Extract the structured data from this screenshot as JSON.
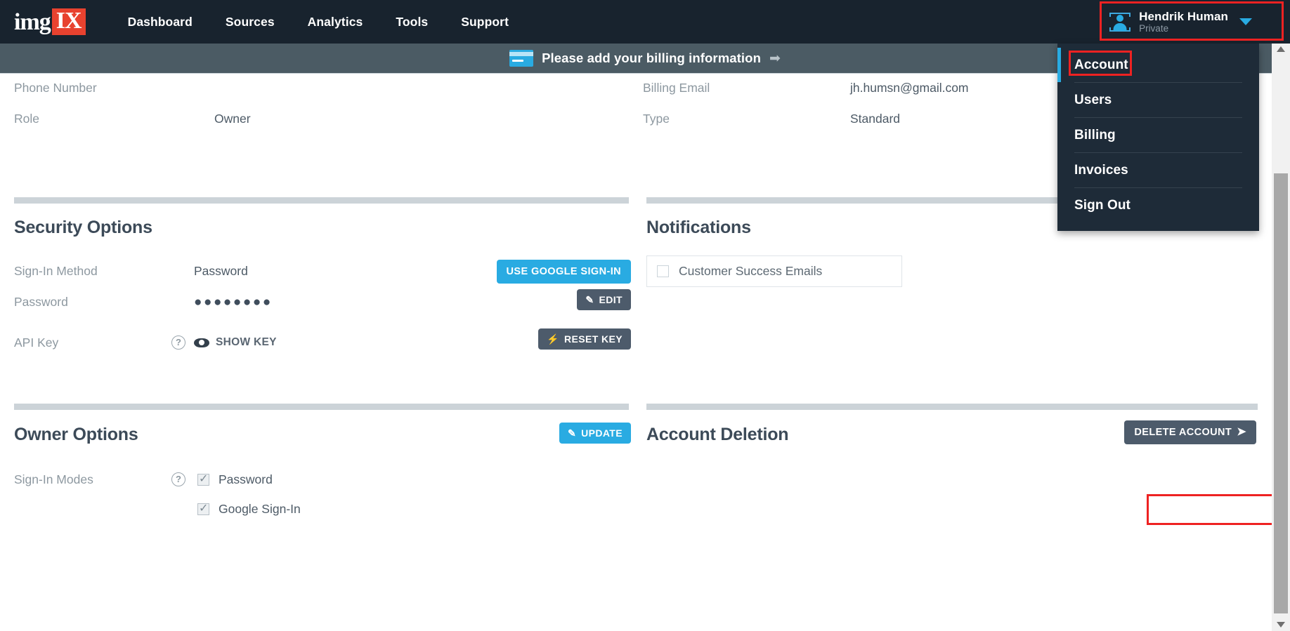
{
  "brand": {
    "logo_img": "img",
    "logo_ix": "IX",
    "accent": "#29abe2",
    "logo_red": "#e8422f"
  },
  "nav": {
    "items": [
      {
        "label": "Dashboard",
        "name": "nav-dashboard"
      },
      {
        "label": "Sources",
        "name": "nav-sources"
      },
      {
        "label": "Analytics",
        "name": "nav-analytics"
      },
      {
        "label": "Tools",
        "name": "nav-tools"
      },
      {
        "label": "Support",
        "name": "nav-support"
      }
    ]
  },
  "user": {
    "name": "Hendrik Human",
    "subtitle": "Private",
    "avatar_icon": "user-avatar-icon",
    "chevron_icon": "chevron-down-icon"
  },
  "user_menu": {
    "items": [
      {
        "label": "Account",
        "active": true
      },
      {
        "label": "Users",
        "active": false
      },
      {
        "label": "Billing",
        "active": false
      },
      {
        "label": "Invoices",
        "active": false
      },
      {
        "label": "Sign Out",
        "active": false
      }
    ]
  },
  "banner": {
    "icon": "credit-card-icon",
    "text": "Please add your billing information",
    "arrow": "➡"
  },
  "account_info": {
    "left": [
      {
        "label": "Phone Number",
        "value": ""
      },
      {
        "label": "Role",
        "value": "Owner"
      }
    ],
    "right": [
      {
        "label": "Billing Email",
        "value": "jh.humsn@gmail.com"
      },
      {
        "label": "Type",
        "value": "Standard"
      }
    ]
  },
  "security": {
    "title": "Security Options",
    "rows": {
      "signin_method": {
        "label": "Sign-In Method",
        "value": "Password"
      },
      "password": {
        "label": "Password",
        "value": "●●●●●●●●"
      },
      "api_key": {
        "label": "API Key",
        "help_icon": "help-circle-icon",
        "show_key": "SHOW KEY",
        "eye_icon": "eye-icon"
      }
    },
    "buttons": {
      "google_signin": "USE GOOGLE SIGN-IN",
      "edit": "EDIT",
      "reset_key": "RESET KEY"
    },
    "icons": {
      "edit": "pencil-icon",
      "reset": "bolt-icon"
    }
  },
  "notifications": {
    "title": "Notifications",
    "items": [
      {
        "label": "Customer Success Emails",
        "checked": false
      }
    ]
  },
  "owner_options": {
    "title": "Owner Options",
    "update_button": "UPDATE",
    "update_icon": "pencil-icon",
    "signin_modes": {
      "label": "Sign-In Modes",
      "help_icon": "help-circle-icon",
      "modes": [
        {
          "label": "Password",
          "checked": true
        },
        {
          "label": "Google Sign-In",
          "checked": true
        }
      ]
    }
  },
  "account_deletion": {
    "title": "Account Deletion",
    "delete_button": "DELETE ACCOUNT",
    "arrow_icon": "arrow-right-icon"
  },
  "scrollbar": {
    "up_icon": "scroll-up-arrow-icon",
    "down_icon": "scroll-down-arrow-icon"
  }
}
